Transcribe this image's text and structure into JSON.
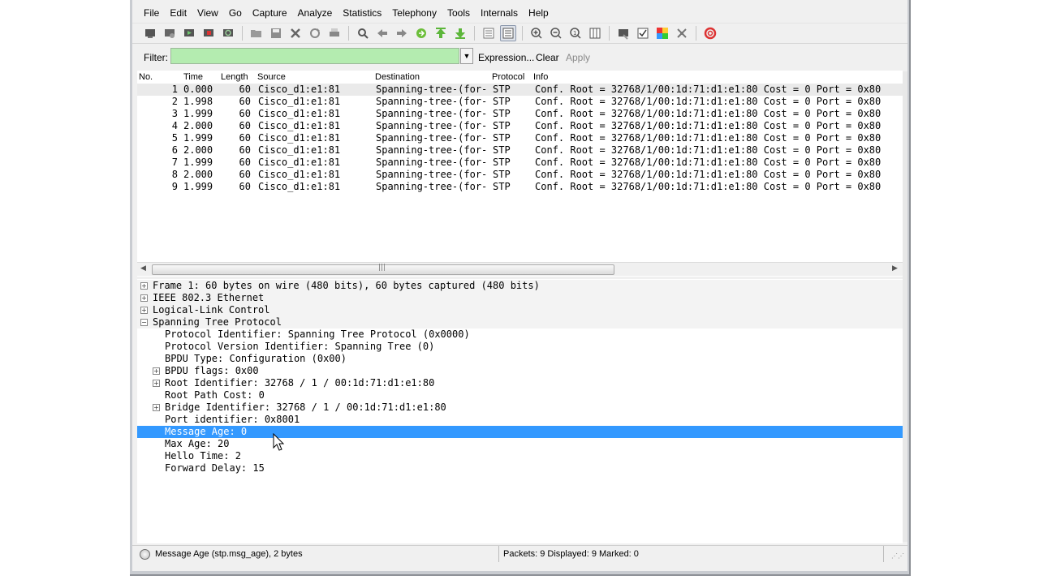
{
  "menu": [
    "File",
    "Edit",
    "View",
    "Go",
    "Capture",
    "Analyze",
    "Statistics",
    "Telephony",
    "Tools",
    "Internals",
    "Help"
  ],
  "toolbar_icons": [
    "interfaces-icon",
    "options-icon",
    "start-icon",
    "stop-icon",
    "restart-icon",
    "|",
    "open-icon",
    "save-icon",
    "close-icon",
    "reload-icon",
    "print-icon",
    "|",
    "find-icon",
    "back-icon",
    "forward-icon",
    "goto-icon",
    "first-icon",
    "last-icon",
    "|",
    "colorize-icon",
    "autoscroll-icon",
    "|",
    "zoom-in-icon",
    "zoom-out-icon",
    "zoom-normal-icon",
    "resize-columns-icon",
    "|",
    "capture-filters-icon",
    "display-filters-icon",
    "coloring-rules-icon",
    "preferences-icon",
    "|",
    "help-icon"
  ],
  "filter": {
    "label": "Filter:",
    "value": "",
    "expression_label": "Expression...",
    "clear_label": "Clear",
    "apply_label": "Apply"
  },
  "packet_list": {
    "columns": [
      "No.",
      "Time",
      "Length",
      "Source",
      "Destination",
      "Protocol",
      "Info"
    ],
    "rows": [
      {
        "no": "1",
        "time": "0.000",
        "len": "60",
        "src": "Cisco_d1:e1:81",
        "dst": "Spanning-tree-(for-",
        "proto": "STP",
        "info": "Conf. Root = 32768/1/00:1d:71:d1:e1:80  Cost = 0  Port = 0x80"
      },
      {
        "no": "2",
        "time": "1.998",
        "len": "60",
        "src": "Cisco_d1:e1:81",
        "dst": "Spanning-tree-(for-",
        "proto": "STP",
        "info": "Conf. Root = 32768/1/00:1d:71:d1:e1:80  Cost = 0  Port = 0x80"
      },
      {
        "no": "3",
        "time": "1.999",
        "len": "60",
        "src": "Cisco_d1:e1:81",
        "dst": "Spanning-tree-(for-",
        "proto": "STP",
        "info": "Conf. Root = 32768/1/00:1d:71:d1:e1:80  Cost = 0  Port = 0x80"
      },
      {
        "no": "4",
        "time": "2.000",
        "len": "60",
        "src": "Cisco_d1:e1:81",
        "dst": "Spanning-tree-(for-",
        "proto": "STP",
        "info": "Conf. Root = 32768/1/00:1d:71:d1:e1:80  Cost = 0  Port = 0x80"
      },
      {
        "no": "5",
        "time": "1.999",
        "len": "60",
        "src": "Cisco_d1:e1:81",
        "dst": "Spanning-tree-(for-",
        "proto": "STP",
        "info": "Conf. Root = 32768/1/00:1d:71:d1:e1:80  Cost = 0  Port = 0x80"
      },
      {
        "no": "6",
        "time": "2.000",
        "len": "60",
        "src": "Cisco_d1:e1:81",
        "dst": "Spanning-tree-(for-",
        "proto": "STP",
        "info": "Conf. Root = 32768/1/00:1d:71:d1:e1:80  Cost = 0  Port = 0x80"
      },
      {
        "no": "7",
        "time": "1.999",
        "len": "60",
        "src": "Cisco_d1:e1:81",
        "dst": "Spanning-tree-(for-",
        "proto": "STP",
        "info": "Conf. Root = 32768/1/00:1d:71:d1:e1:80  Cost = 0  Port = 0x80"
      },
      {
        "no": "8",
        "time": "2.000",
        "len": "60",
        "src": "Cisco_d1:e1:81",
        "dst": "Spanning-tree-(for-",
        "proto": "STP",
        "info": "Conf. Root = 32768/1/00:1d:71:d1:e1:80  Cost = 0  Port = 0x80"
      },
      {
        "no": "9",
        "time": "1.999",
        "len": "60",
        "src": "Cisco_d1:e1:81",
        "dst": "Spanning-tree-(for-",
        "proto": "STP",
        "info": "Conf. Root = 32768/1/00:1d:71:d1:e1:80  Cost = 0  Port = 0x80"
      }
    ]
  },
  "details": [
    {
      "text": "Frame 1: 60 bytes on wire (480 bits), 60 bytes captured (480 bits)",
      "indent": 0,
      "expander": "+",
      "top": true
    },
    {
      "text": "IEEE 802.3 Ethernet",
      "indent": 0,
      "expander": "+",
      "top": true
    },
    {
      "text": "Logical-Link Control",
      "indent": 0,
      "expander": "+",
      "top": true
    },
    {
      "text": "Spanning Tree Protocol",
      "indent": 0,
      "expander": "-",
      "top": true
    },
    {
      "text": "Protocol Identifier: Spanning Tree Protocol (0x0000)",
      "indent": 1,
      "expander": ""
    },
    {
      "text": "Protocol Version Identifier: Spanning Tree (0)",
      "indent": 1,
      "expander": ""
    },
    {
      "text": "BPDU Type: Configuration (0x00)",
      "indent": 1,
      "expander": ""
    },
    {
      "text": "BPDU flags: 0x00",
      "indent": 1,
      "expander": "+"
    },
    {
      "text": "Root Identifier: 32768 / 1 / 00:1d:71:d1:e1:80",
      "indent": 1,
      "expander": "+"
    },
    {
      "text": "Root Path Cost: 0",
      "indent": 1,
      "expander": ""
    },
    {
      "text": "Bridge Identifier: 32768 / 1 / 00:1d:71:d1:e1:80",
      "indent": 1,
      "expander": "+"
    },
    {
      "text": "Port identifier: 0x8001",
      "indent": 1,
      "expander": ""
    },
    {
      "text": "Message Age: 0",
      "indent": 1,
      "expander": "",
      "selected": true
    },
    {
      "text": "Max Age: 20",
      "indent": 1,
      "expander": ""
    },
    {
      "text": "Hello Time: 2",
      "indent": 1,
      "expander": ""
    },
    {
      "text": "Forward Delay: 15",
      "indent": 1,
      "expander": ""
    }
  ],
  "status": {
    "field_info": "Message Age (stp.msg_age), 2 bytes",
    "packets_info": "Packets: 9 Displayed: 9 Marked: 0"
  },
  "colors": {
    "selection": "#3399ff",
    "filter_valid": "#b4ecb0"
  }
}
